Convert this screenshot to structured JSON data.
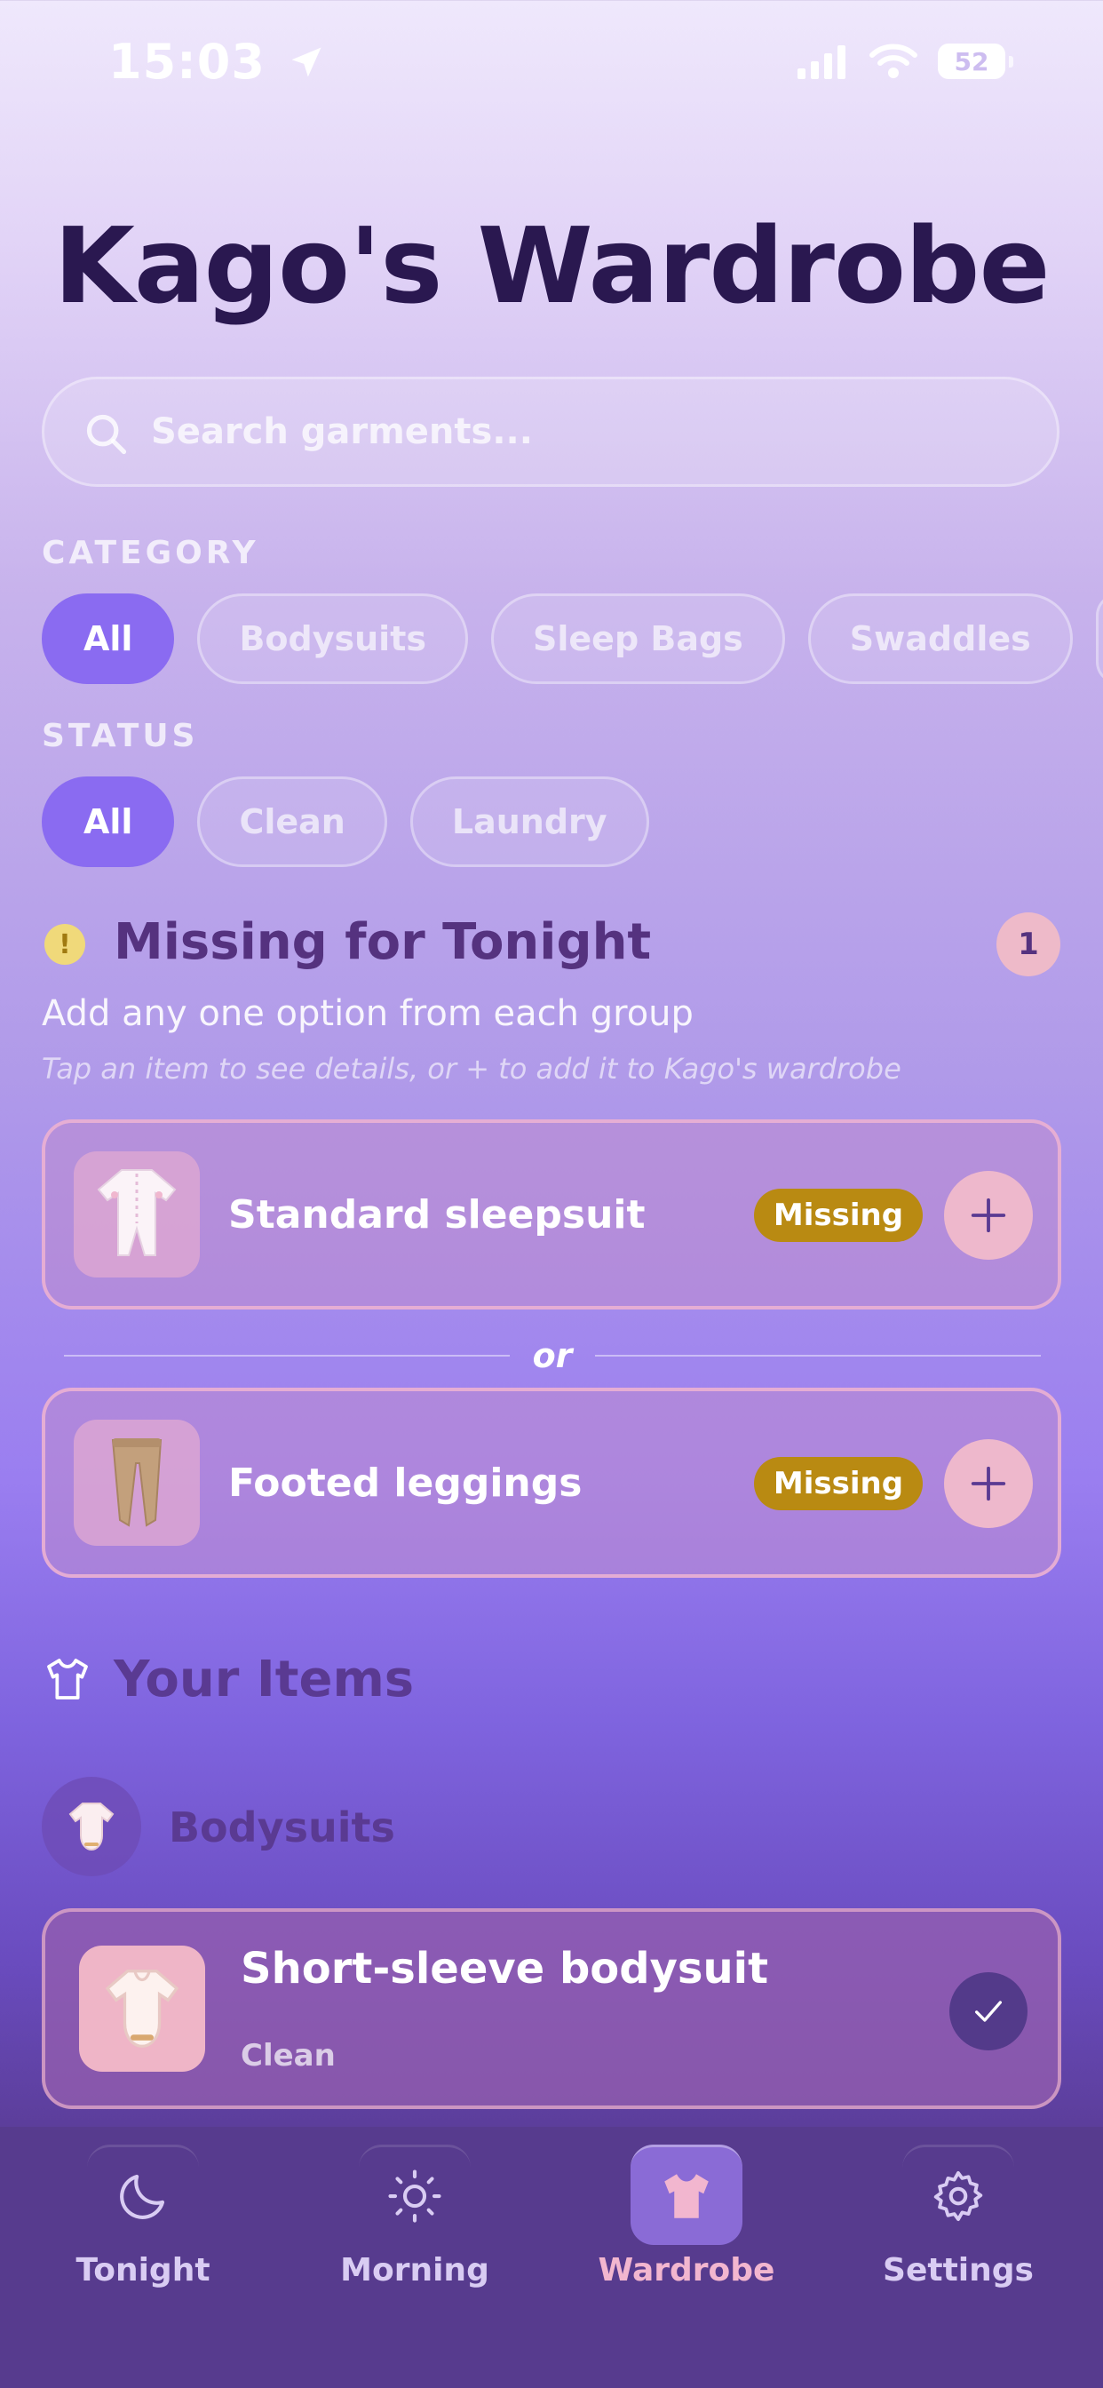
{
  "status_bar": {
    "time": "15:03",
    "battery": "52"
  },
  "header": {
    "title": "Kago's Wardrobe"
  },
  "search": {
    "placeholder": "Search garments..."
  },
  "category": {
    "label": "CATEGORY",
    "chips": [
      "All",
      "Bodysuits",
      "Sleep Bags",
      "Swaddles"
    ],
    "selected": "All"
  },
  "status_filter": {
    "label": "STATUS",
    "chips": [
      "All",
      "Clean",
      "Laundry"
    ],
    "selected": "All"
  },
  "missing": {
    "title": "Missing for Tonight",
    "count": "1",
    "subtitle": "Add any one option from each group",
    "hint": "Tap an item to see details, or + to add it to Kago's wardrobe",
    "separator": "or",
    "options": [
      {
        "label": "Standard sleepsuit",
        "badge": "Missing",
        "icon": "sleepsuit-icon"
      },
      {
        "label": "Footed leggings",
        "badge": "Missing",
        "icon": "leggings-icon"
      }
    ]
  },
  "items": {
    "title": "Your Items",
    "groups": [
      {
        "label": "Bodysuits",
        "entries": [
          {
            "name": "Short-sleeve bodysuit",
            "status": "Clean"
          }
        ]
      }
    ]
  },
  "tabs": [
    {
      "label": "Tonight",
      "icon": "moon-icon",
      "active": false
    },
    {
      "label": "Morning",
      "icon": "sun-icon",
      "active": false
    },
    {
      "label": "Wardrobe",
      "icon": "shirt-icon",
      "active": true
    },
    {
      "label": "Settings",
      "icon": "gear-icon",
      "active": false
    }
  ],
  "colors": {
    "accent": "#8a6bf1",
    "missing_badge": "#b98a12",
    "tab_active_label": "#f2b6cf"
  }
}
